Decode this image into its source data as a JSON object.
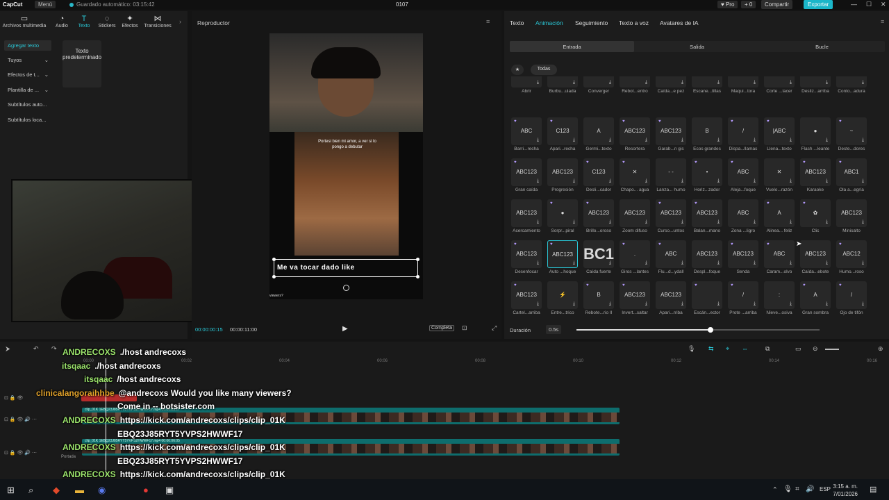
{
  "titlebar": {
    "logo": "CapCut",
    "menu": "Menú",
    "autosave": "Guardado automático: 03:15:42",
    "project": "0107",
    "pro": "♥ Pro",
    "plus": "+ 0",
    "share": "Compartir",
    "export": "Exportar"
  },
  "toptools": [
    {
      "label": "Archivos multimedia",
      "icon": "▭"
    },
    {
      "label": "Audio",
      "icon": "◔"
    },
    {
      "label": "Texto",
      "icon": "T"
    },
    {
      "label": "Stickers",
      "icon": "◌"
    },
    {
      "label": "Efectos",
      "icon": "✦"
    },
    {
      "label": "Transiciones",
      "icon": "⋈"
    }
  ],
  "sidebar": {
    "items": [
      "Agregar texto",
      "Tuyos",
      "Efectos de t...",
      "Plantilla de ...",
      "Subtítulos auto...",
      "Subtítulos loca..."
    ],
    "card": "Texto predeterminado"
  },
  "player": {
    "title": "Reproductor",
    "caption": "Portesi bien mi amor, a ver si lo pongo a debutar",
    "overlay_text": "Me va tocar dado like",
    "viewers": "viewers?",
    "time_current": "00:00:00:15",
    "time_total": "00:00:11:00",
    "ratio": "Completa"
  },
  "rightpanel": {
    "tabs": [
      "Texto",
      "Animación",
      "Seguimiento",
      "Texto a voz",
      "Avatares de IA"
    ],
    "subtabs": [
      "Entrada",
      "Salida",
      "Bucle"
    ],
    "filter_all": "Todas",
    "duration_label": "Duración",
    "duration_value": "0.5s",
    "duration_fraction": 0.55,
    "effects": [
      {
        "t": "BCT",
        "l": "Abrir"
      },
      {
        "t": "ABC",
        "l": "Burbu...ulada"
      },
      {
        "t": "ABC1",
        "l": "Converger"
      },
      {
        "t": "ABC123",
        "l": "Rebot...entro"
      },
      {
        "t": "ABC123",
        "l": "Caída...e pez"
      },
      {
        "t": "ABC123",
        "l": "Escane...tillas"
      },
      {
        "t": "ABC1",
        "l": "Maqui...tora"
      },
      {
        "t": "ABC1",
        "l": "Corte ...lacer"
      },
      {
        "t": "Ag",
        "l": "Desliz...arriba"
      },
      {
        "t": "~",
        "l": "Conto...adura"
      },
      {
        "t": "ABC",
        "l": "Barri...recha"
      },
      {
        "t": "C123",
        "l": "Apari...recha"
      },
      {
        "t": "A",
        "l": "Germi...texto"
      },
      {
        "t": "ABC123",
        "l": "Resortera"
      },
      {
        "t": "ABC123",
        "l": "Garab...n gis"
      },
      {
        "t": "B",
        "l": "Ecos grandes"
      },
      {
        "t": "/",
        "l": "Dispa...llamas"
      },
      {
        "t": "|ABC",
        "l": "Llena...texto"
      },
      {
        "t": "●",
        "l": "Flash ...leante"
      },
      {
        "t": "~",
        "l": "Deste...dores"
      },
      {
        "t": "ABC123",
        "l": "Gran caída"
      },
      {
        "t": "ABC123",
        "l": "Progresión"
      },
      {
        "t": "C123",
        "l": "Desli...cador"
      },
      {
        "t": "✕",
        "l": "Chapo... agua"
      },
      {
        "t": "- -",
        "l": "Lanza... humo"
      },
      {
        "t": "•",
        "l": "Horiz...zador"
      },
      {
        "t": "ABC",
        "l": "Aleja...foque"
      },
      {
        "t": "✕",
        "l": "Vuelo...razón"
      },
      {
        "t": "ABC123",
        "l": "Karaoke"
      },
      {
        "t": "ABC1",
        "l": "Ola a...egría"
      },
      {
        "t": "ABC123",
        "l": "Acercamiento"
      },
      {
        "t": "●",
        "l": "Sorpr...piral"
      },
      {
        "t": "ABC123",
        "l": "Brillo...oroso"
      },
      {
        "t": "ABC123",
        "l": "Zoom difuso"
      },
      {
        "t": "ABC123",
        "l": "Curso...untos"
      },
      {
        "t": "ABC123",
        "l": "Balan...mano"
      },
      {
        "t": "ABC",
        "l": "Zona ...ligro"
      },
      {
        "t": "A",
        "l": "Alinea... feliz"
      },
      {
        "t": "✿",
        "l": "Clic"
      },
      {
        "t": "ABC123",
        "l": "Minisalto"
      },
      {
        "t": "ABC123",
        "l": "Desenfocar"
      },
      {
        "t": "ABC123",
        "l": "Auto ...hoque"
      },
      {
        "t": "BC1",
        "l": "Caída fuerte"
      },
      {
        "t": ".",
        "l": "Giros ...lantes"
      },
      {
        "t": "ABC",
        "l": "Flu...d...ydall"
      },
      {
        "t": "ABC123",
        "l": "Despl...foque"
      },
      {
        "t": "ABC123",
        "l": "Senda"
      },
      {
        "t": "ABC",
        "l": "Caram...olvo"
      },
      {
        "t": "ABC123",
        "l": "Caída...ebote"
      },
      {
        "t": "ABC12",
        "l": "Humo...roso"
      },
      {
        "t": "ABC123",
        "l": "Cartel...arriba"
      },
      {
        "t": "⚡",
        "l": "Entre...trico"
      },
      {
        "t": "B",
        "l": "Rebote...rio II"
      },
      {
        "t": "ABC123",
        "l": "Invert...saltar"
      },
      {
        "t": "ABC123",
        "l": "Apari...rriba"
      },
      {
        "t": "",
        "l": "Escán...ector"
      },
      {
        "t": "/",
        "l": "Prote ...arriba"
      },
      {
        "t": ":",
        "l": "Nieve...osiva"
      },
      {
        "t": "A",
        "l": "Gran sombra"
      },
      {
        "t": "/",
        "l": "Ojo de tifón"
      }
    ]
  },
  "timeline": {
    "ruler": [
      "00:00",
      "00:02",
      "00:04",
      "00:06",
      "00:08",
      "00:10",
      "00:12",
      "00:14",
      "00:16"
    ],
    "clip1_cap": "clip_01K 1EBQ23J85RYT5YVPS2HWWF17.mp4  00:00:03:27",
    "clip2_cap": "clip_01K 1EBQ23J85RYT5YVPS2HWWF17.mp4  00:00:06:05",
    "cover_label": "Portada"
  },
  "chat": [
    {
      "user": "ANDRECOXS",
      "msg": "./host andrecoxs",
      "color": "#9be36b"
    },
    {
      "user": "itsqaac",
      "msg": "./host andrecoxs",
      "color": "#9be36b"
    },
    {
      "user": "itsqaac",
      "msg": "/host andrecoxs",
      "color": "#9be36b"
    },
    {
      "user": "clinicalangoraihhbe",
      "msg": "@andrecoxs Would you like many viewers?",
      "color": "#e0a12a"
    },
    {
      "user": "",
      "msg": "Come in -- botsister.com",
      "color": "#e0a12a"
    },
    {
      "user": "ANDRECOXS",
      "msg": "https://kick.com/andrecoxs/clips/clip_01K",
      "color": "#9be36b"
    },
    {
      "user": "",
      "msg": "EBQ23J85RYT5YVPS2HWWF17",
      "color": "#9be36b"
    },
    {
      "user": "ANDRECOXS",
      "msg": "https://kick.com/andrecoxs/clips/clip_01K",
      "color": "#9be36b"
    },
    {
      "user": "",
      "msg": "EBQ23J85RYT5YVPS2HWWF17",
      "color": "#9be36b"
    },
    {
      "user": "ANDRECOXS",
      "msg": "https://kick.com/andrecoxs/clips/clip_01K",
      "color": "#9be36b"
    },
    {
      "user": "",
      "msg": "EBQ23J85RYT5YVPS2HWWF17",
      "color": "#9be36b"
    }
  ],
  "taskbar": {
    "lang": "ESP",
    "time": "3:15 a. m.",
    "date": "7/01/2026"
  }
}
